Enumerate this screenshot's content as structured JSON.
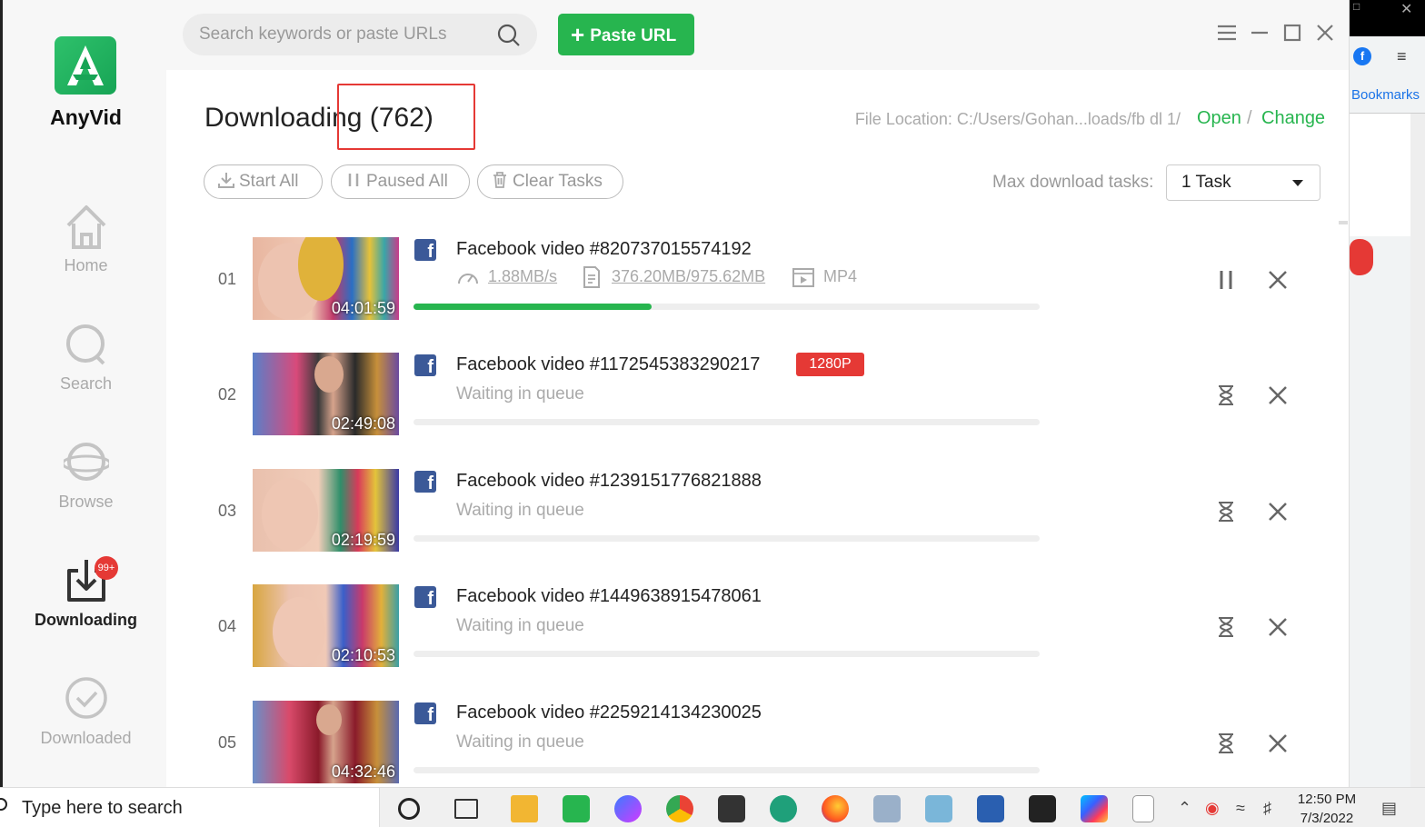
{
  "app": {
    "name": "AnyVid"
  },
  "nav": {
    "home": "Home",
    "search": "Search",
    "browse": "Browse",
    "downloading": "Downloading",
    "downloading_badge": "99+",
    "downloaded": "Downloaded"
  },
  "topbar": {
    "search_placeholder": "Search keywords or paste URLs",
    "paste_url": "Paste URL"
  },
  "main": {
    "title": "Downloading (762)",
    "file_location": "File Location: C:/Users/Gohan...loads/fb dl 1/",
    "open": "Open",
    "slash": "/",
    "change": "Change",
    "start_all": "Start All",
    "paused_all": "Paused All",
    "clear_tasks": "Clear Tasks",
    "max_tasks_label": "Max download tasks:",
    "max_tasks_value": "1 Task"
  },
  "downloads": [
    {
      "index": "01",
      "duration": "04:01:59",
      "title": "Facebook video #820737015574192",
      "speed": "1.88MB/s",
      "size": "376.20MB/975.62MB",
      "format": "MP4",
      "progress": 0.38
    },
    {
      "index": "02",
      "duration": "02:49:08",
      "title": "Facebook video #1172545383290217",
      "resolution": "1280P",
      "status": "Waiting in queue",
      "progress": 0
    },
    {
      "index": "03",
      "duration": "02:19:59",
      "title": "Facebook video #1239151776821888",
      "status": "Waiting in queue",
      "progress": 0
    },
    {
      "index": "04",
      "duration": "02:10:53",
      "title": "Facebook video #1449638915478061",
      "status": "Waiting in queue",
      "progress": 0
    },
    {
      "index": "05",
      "duration": "04:32:46",
      "title": "Facebook video #2259214134230025",
      "status": "Waiting in queue",
      "progress": 0
    }
  ],
  "browser_bg": {
    "bookmarks": "Bookmarks"
  },
  "taskbar": {
    "search_placeholder": "Type here to search",
    "time": "12:50 PM",
    "date": "7/3/2022"
  },
  "colors": {
    "accent": "#27b54f",
    "badge": "#e53935",
    "facebook": "#3b5998"
  }
}
